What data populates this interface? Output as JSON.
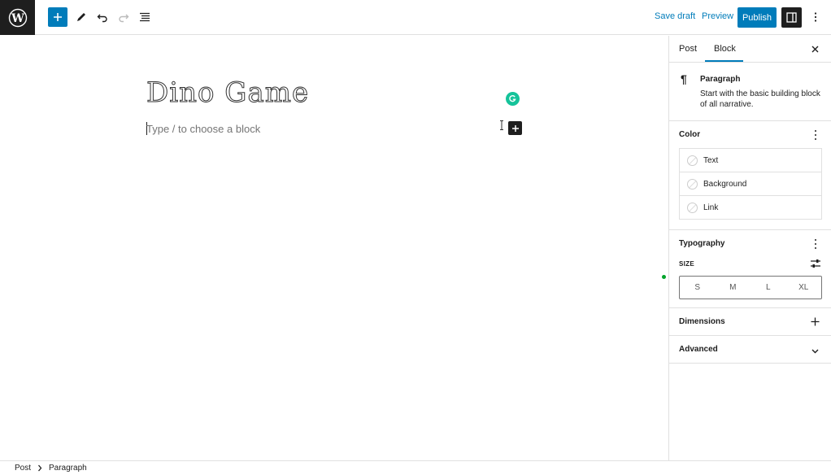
{
  "toolbar": {
    "logo_icon": "wordpress-logo",
    "add_icon": "plus-icon",
    "tools_icon": "pencil-icon",
    "undo_icon": "undo-icon",
    "redo_icon": "redo-icon",
    "list_view_icon": "list-view-icon",
    "save_draft_label": "Save draft",
    "preview_label": "Preview",
    "publish_label": "Publish",
    "settings_icon": "sidebar-toggle-icon",
    "options_icon": "kebab-icon"
  },
  "editor": {
    "post_title": "Dino Game",
    "block_placeholder": "Type / to choose a block",
    "grammarly_icon": "grammarly-icon",
    "inserter_icon": "plus-icon"
  },
  "sidebar": {
    "tabs": [
      {
        "label": "Post",
        "active": false
      },
      {
        "label": "Block",
        "active": true
      }
    ],
    "close_icon": "close-icon",
    "block_card": {
      "icon": "pilcrow-icon",
      "name": "Paragraph",
      "description": "Start with the basic building block of all narrative."
    },
    "color_panel": {
      "title": "Color",
      "items": [
        {
          "label": "Text"
        },
        {
          "label": "Background"
        },
        {
          "label": "Link"
        }
      ]
    },
    "typography_panel": {
      "title": "Typography",
      "size_label": "SIZE",
      "size_options": [
        "S",
        "M",
        "L",
        "XL"
      ]
    },
    "dimensions_panel": {
      "title": "Dimensions"
    },
    "advanced_panel": {
      "title": "Advanced"
    }
  },
  "breadcrumb": {
    "items": [
      "Post",
      "Paragraph"
    ]
  },
  "colors": {
    "accent": "#007cba",
    "dark": "#1e1e1e",
    "grammarly": "#15c39a"
  }
}
